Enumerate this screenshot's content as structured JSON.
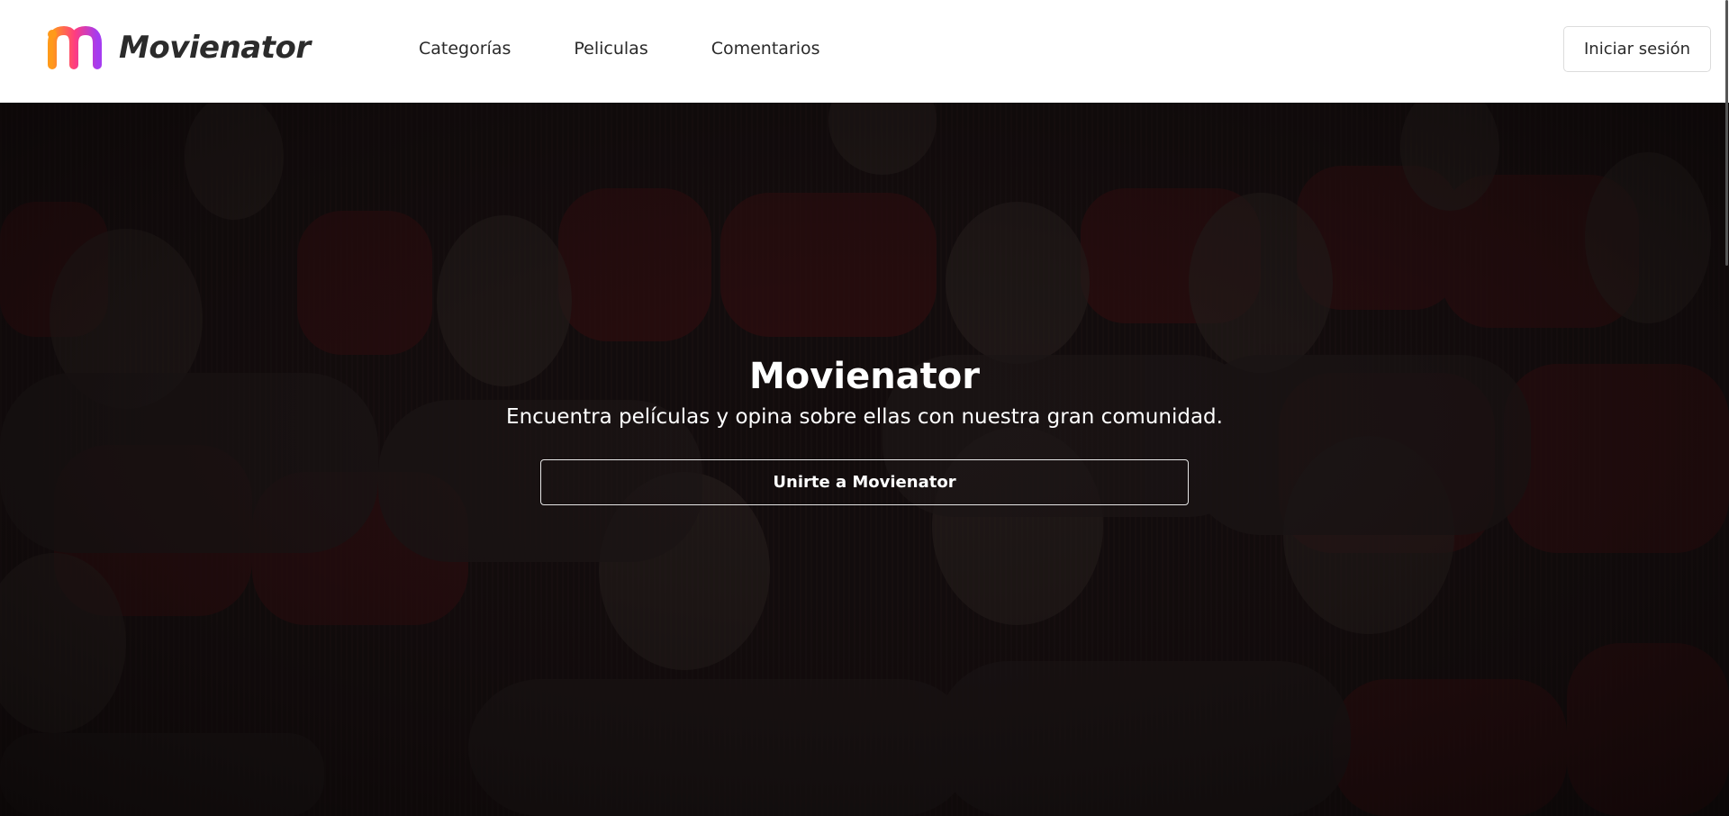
{
  "brand": {
    "name": "Movienator",
    "colors": [
      "#ff9a1a",
      "#ff3d7f",
      "#a53cf0"
    ]
  },
  "nav": {
    "links": [
      {
        "label": "Categorías"
      },
      {
        "label": "Peliculas"
      },
      {
        "label": "Comentarios"
      }
    ],
    "login_label": "Iniciar sesión"
  },
  "hero": {
    "title": "Movienator",
    "subtitle": "Encuentra películas y opina sobre ellas con nuestra gran comunidad.",
    "cta_label": "Unirte a Movienator",
    "background": "cinema-audience-photo"
  },
  "colors": {
    "nav_bg": "#ffffff",
    "nav_text": "#2a2a2a",
    "hero_overlay": "#160f10",
    "hero_text": "#ffffff",
    "seat_red": "#5e1616"
  }
}
